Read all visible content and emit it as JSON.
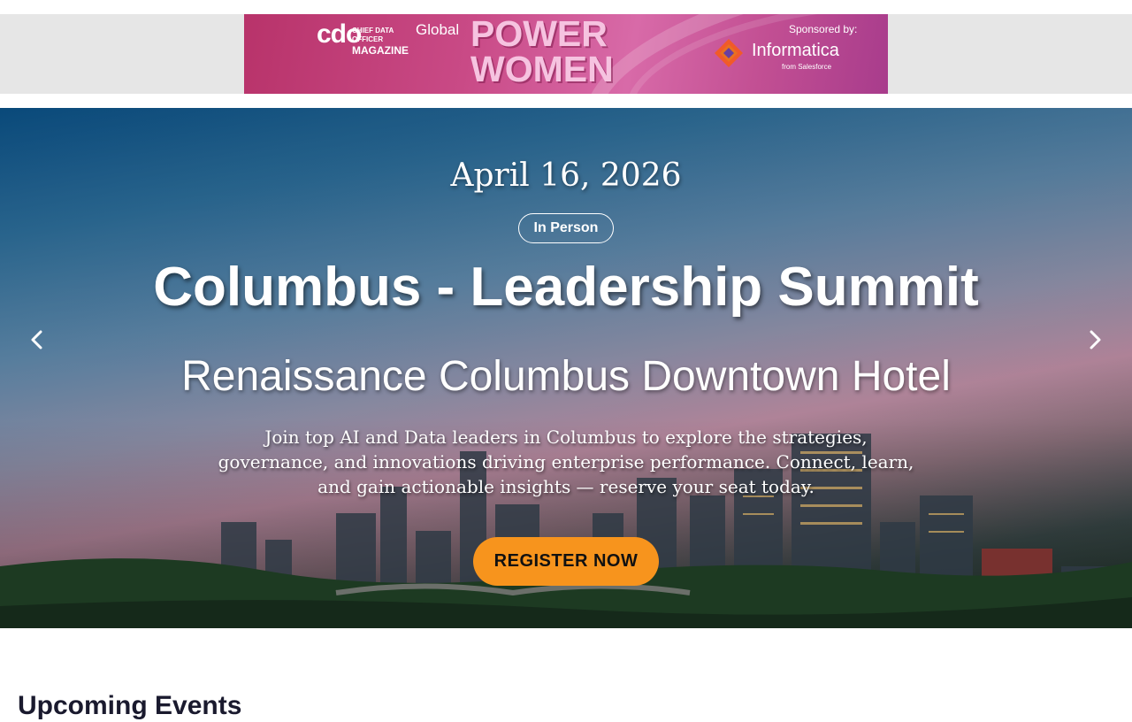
{
  "ad_banner": {
    "brand": "cdo",
    "brand_sub_1": "CHIEF DATA OFFICER",
    "brand_sub_2": "MAGAZINE",
    "global_label": "Global",
    "headline_line1": "POWER",
    "headline_line2": "WOMEN",
    "sponsor_label": "Sponsored by:",
    "sponsor_name": "Informatica",
    "sponsor_sub": "from Salesforce",
    "colors": {
      "background": "#c94a86",
      "headline": "#f6c3e0"
    }
  },
  "hero": {
    "date": "April 16, 2026",
    "badge": "In Person",
    "title": "Columbus - Leadership Summit",
    "venue": "Renaissance Columbus Downtown Hotel",
    "description": "Join top AI and Data leaders in Columbus to explore the strategies, governance, and innovations driving enterprise performance. Connect, learn, and gain actionable insights — reserve your seat today.",
    "cta_label": "REGISTER NOW",
    "prev_icon": "chevron-left-icon",
    "next_icon": "chevron-right-icon",
    "colors": {
      "cta": "#f7941d"
    }
  },
  "upcoming": {
    "title": "Upcoming Events"
  }
}
